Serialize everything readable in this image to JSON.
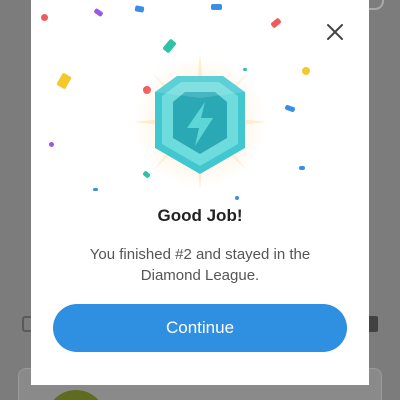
{
  "dialog": {
    "title": "Good Job!",
    "message": "You finished #2 and stayed in the Diamond League.",
    "continue_label": "Continue",
    "badge_icon": "lightning-bolt-icon",
    "close_icon": "close-icon"
  },
  "colors": {
    "accent": "#2f8fe0",
    "badge_main": "#5fd6d6",
    "badge_dark": "#2aa9b5",
    "badge_glow": "#ffe6c2",
    "overlay": "#7c7c7c"
  }
}
